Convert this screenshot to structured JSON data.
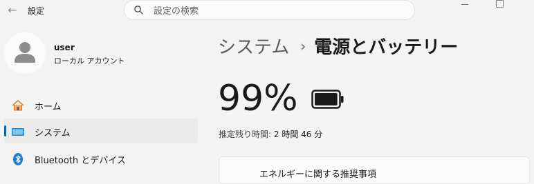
{
  "app": {
    "title": "設定"
  },
  "search": {
    "placeholder": "設定の検索"
  },
  "user": {
    "name": "user",
    "account_type": "ローカル アカウント"
  },
  "sidebar": {
    "items": [
      {
        "label": "ホーム",
        "icon": "home-icon",
        "active": false
      },
      {
        "label": "システム",
        "icon": "monitor-icon",
        "active": true
      },
      {
        "label": "Bluetooth とデバイス",
        "icon": "bluetooth-icon",
        "active": false
      }
    ]
  },
  "breadcrumb": {
    "parent": "システム",
    "separator": "›",
    "current": "電源とバッテリー"
  },
  "battery": {
    "percent": 99,
    "percent_text": "99%",
    "remaining_label": "推定残り時間:",
    "remaining_value": "2 時間 46 分"
  },
  "recommendations": {
    "title": "エネルギーに関する推奨事項"
  },
  "colors": {
    "accent": "#0067c0",
    "background": "#f3f3f3",
    "card": "#fbfbfb"
  }
}
